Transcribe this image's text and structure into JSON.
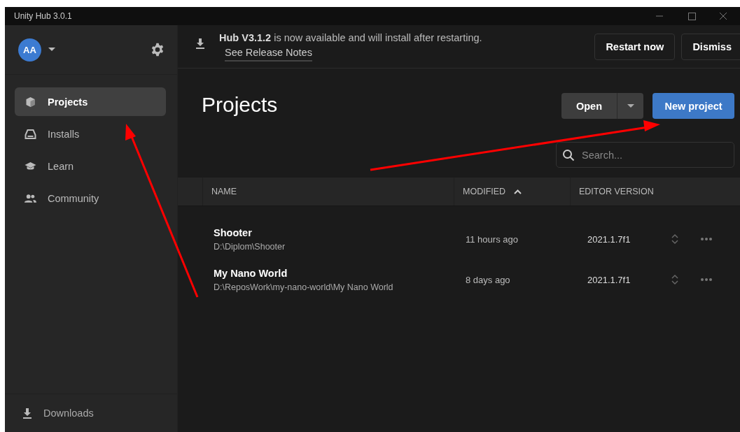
{
  "window": {
    "title": "Unity Hub 3.0.1"
  },
  "sidebar": {
    "avatar": "AA",
    "items": [
      {
        "label": "Projects",
        "selected": true
      },
      {
        "label": "Installs",
        "selected": false
      },
      {
        "label": "Learn",
        "selected": false
      },
      {
        "label": "Community",
        "selected": false
      }
    ],
    "footer": {
      "label": "Downloads"
    }
  },
  "banner": {
    "message": "**Hub V3.1.2** is now available and will install after restarting.",
    "link": "See Release Notes",
    "buttons": [
      "Restart now",
      "Dismiss"
    ]
  },
  "page": {
    "title": "Projects",
    "open_button": "Open",
    "new_button": "New project",
    "search": {
      "placeholder": "Search..."
    }
  },
  "table": {
    "columns": [
      {
        "label": "NAME",
        "sorted": false
      },
      {
        "label": "MODIFIED",
        "sorted": true
      },
      {
        "label": "EDITOR VERSION",
        "sorted": false
      }
    ],
    "rows": [
      {
        "name": "Shooter",
        "path": "D:\\Diplom\\Shooter",
        "modified": "11 hours ago",
        "version": "2021.1.7f1"
      },
      {
        "name": "My Nano World",
        "path": "D:\\ReposWork\\my-nano-world\\My Nano World",
        "modified": "8 days ago",
        "version": "2021.1.7f1"
      }
    ]
  }
}
